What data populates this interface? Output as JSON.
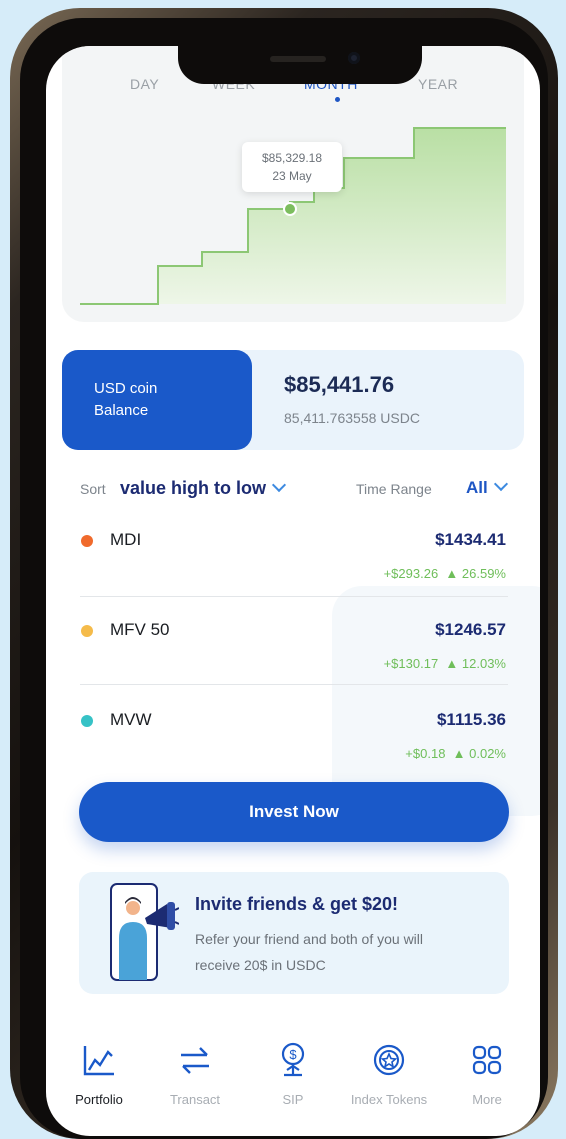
{
  "chart": {
    "ranges": [
      "DAY",
      "WEEK",
      "MONTH",
      "YEAR"
    ],
    "selected_range": "MONTH",
    "tooltip": {
      "value": "$85,329.18",
      "date": "23 May"
    },
    "colors": {
      "line": "#8cc774",
      "fill_top": "#b9dfa4",
      "fill_bottom": "#eef6e8"
    }
  },
  "balance": {
    "label": "USD coin Balance",
    "amount": "$85,441.76",
    "usdc": "85,411.763558 USDC"
  },
  "sort": {
    "label": "Sort",
    "value": "value high to low",
    "time_range_label": "Time Range",
    "time_range_value": "All"
  },
  "holdings": [
    {
      "name": "MDI",
      "value": "$1434.41",
      "change": "+$293.26",
      "percent": "▲ 26.59%",
      "color": "#f06a2c"
    },
    {
      "name": "MFV 50",
      "value": "$1246.57",
      "change": "+$130.17",
      "percent": "▲ 12.03%",
      "color": "#f5bb4a"
    },
    {
      "name": "MVW",
      "value": "$1115.36",
      "change": "+$0.18",
      "percent": "▲ 0.02%",
      "color": "#36c2c6"
    }
  ],
  "invest_button": "Invest Now",
  "invite": {
    "title": "Invite friends & get $20!",
    "text": "Refer your friend and both of you will receive 20$ in USDC"
  },
  "nav": [
    {
      "label": "Portfolio",
      "icon": "chart-icon",
      "active": true
    },
    {
      "label": "Transact",
      "icon": "transfer-arrows-icon",
      "active": false
    },
    {
      "label": "SIP",
      "icon": "dollar-plant-icon",
      "active": false
    },
    {
      "label": "Index Tokens",
      "icon": "token-icon",
      "active": false
    },
    {
      "label": "More",
      "icon": "grid-icon",
      "active": false
    }
  ],
  "accent": "#1a59c9"
}
